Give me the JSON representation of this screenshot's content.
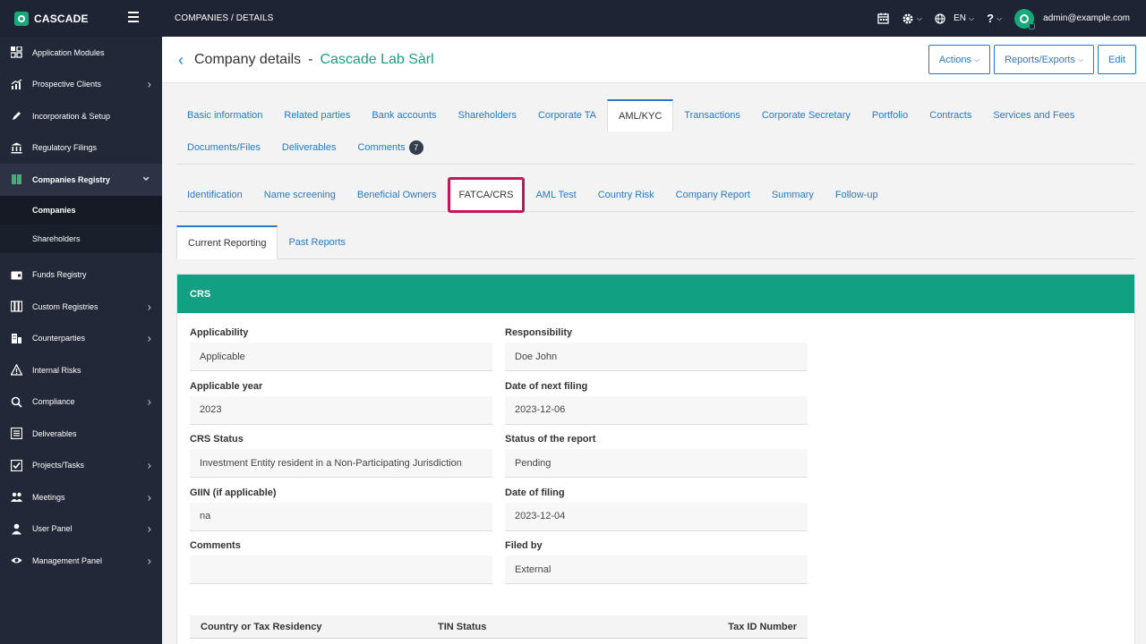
{
  "app": {
    "name": "CASCADE"
  },
  "topbar": {
    "breadcrumb": "COMPANIES  /  DETAILS",
    "language": "EN",
    "help": "?",
    "user_email": "admin@example.com"
  },
  "sidebar": {
    "items": [
      {
        "label": "Application Modules",
        "icon": "grid-icon",
        "chevron": false
      },
      {
        "label": "Prospective Clients",
        "icon": "chart-icon",
        "chevron": true
      },
      {
        "label": "Incorporation & Setup",
        "icon": "pen-icon",
        "chevron": false
      },
      {
        "label": "Regulatory Filings",
        "icon": "bank-icon",
        "chevron": false
      },
      {
        "label": "Companies Registry",
        "icon": "book-icon",
        "chevron": "down"
      }
    ],
    "subitems": [
      {
        "label": "Companies",
        "active": true
      },
      {
        "label": "Shareholders",
        "active": false
      }
    ],
    "items2": [
      {
        "label": "Funds Registry",
        "icon": "wallet-icon",
        "chevron": false
      },
      {
        "label": "Custom Registries",
        "icon": "columns-icon",
        "chevron": true
      },
      {
        "label": "Counterparties",
        "icon": "building-icon",
        "chevron": true
      },
      {
        "label": "Internal Risks",
        "icon": "warning-icon",
        "chevron": false
      },
      {
        "label": "Compliance",
        "icon": "search-icon",
        "chevron": true
      },
      {
        "label": "Deliverables",
        "icon": "list-icon",
        "chevron": false
      },
      {
        "label": "Projects/Tasks",
        "icon": "checkbox-icon",
        "chevron": true
      },
      {
        "label": "Meetings",
        "icon": "users-icon",
        "chevron": true
      },
      {
        "label": "User Panel",
        "icon": "user-icon",
        "chevron": true
      },
      {
        "label": "Management Panel",
        "icon": "eye-icon",
        "chevron": true
      }
    ]
  },
  "header": {
    "title": "Company details",
    "separator": "-",
    "company_name": "Cascade Lab Sàrl",
    "buttons": {
      "actions": "Actions",
      "reports": "Reports/Exports",
      "edit": "Edit"
    }
  },
  "tabs_main": {
    "row1": [
      "Basic information",
      "Related parties",
      "Bank accounts",
      "Shareholders",
      "Corporate TA",
      "AML/KYC",
      "Transactions",
      "Corporate Secretary",
      "Portfolio",
      "Contracts",
      "Services and Fees"
    ],
    "row2": [
      "Documents/Files",
      "Deliverables",
      "Comments"
    ],
    "comments_count": "7",
    "active": "AML/KYC"
  },
  "tabs_aml": {
    "items": [
      "Identification",
      "Name screening",
      "Beneficial Owners",
      "FATCA/CRS",
      "AML Test",
      "Country Risk",
      "Company Report",
      "Summary",
      "Follow-up"
    ],
    "active": "FATCA/CRS"
  },
  "tabs_report": {
    "items": [
      "Current Reporting",
      "Past Reports"
    ],
    "active": "Current Reporting"
  },
  "panel": {
    "title": "CRS",
    "accent_color": "#12a082",
    "fields": [
      {
        "label": "Applicability",
        "value": "Applicable"
      },
      {
        "label": "Responsibility",
        "value": "Doe John"
      },
      {
        "label": "Applicable year",
        "value": "2023"
      },
      {
        "label": "Date of next filing",
        "value": "2023-12-06"
      },
      {
        "label": "CRS Status",
        "value": "Investment Entity resident in a Non-Participating Jurisdiction"
      },
      {
        "label": "Status of the report",
        "value": "Pending"
      },
      {
        "label": "GIIN (if applicable)",
        "value": "na"
      },
      {
        "label": "Date of filing",
        "value": "2023-12-04"
      },
      {
        "label": "Comments",
        "value": ""
      },
      {
        "label": "Filed by",
        "value": "External"
      }
    ],
    "table": {
      "headers": [
        "Country or Tax Residency",
        "TIN Status",
        "Tax ID Number"
      ]
    }
  }
}
